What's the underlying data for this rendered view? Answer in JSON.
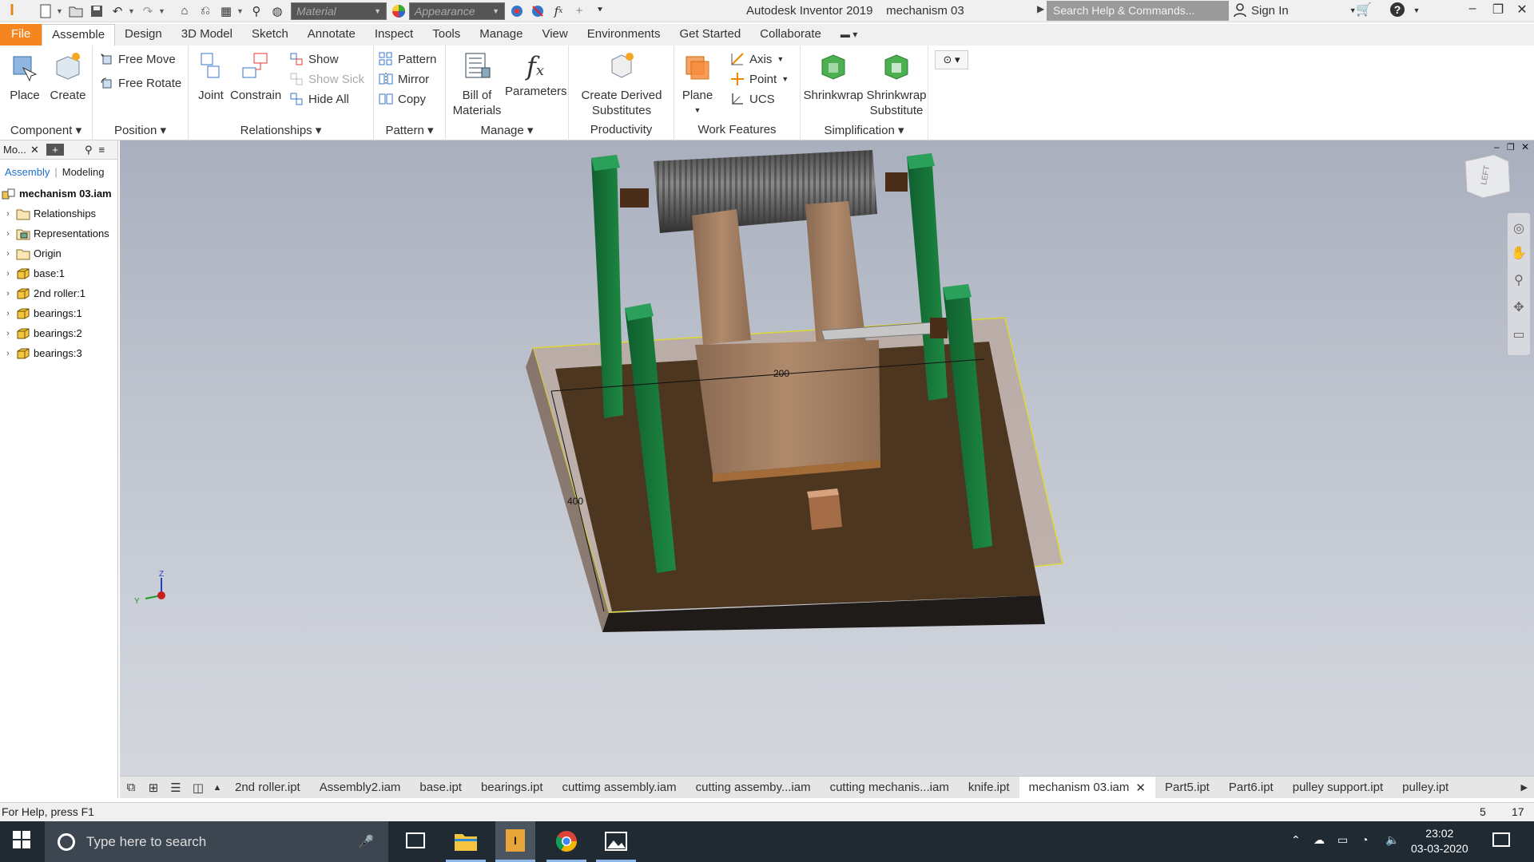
{
  "title_bar": {
    "app_name": "Autodesk Inventor 2019",
    "document_name": "mechanism 03",
    "material_placeholder": "Material",
    "appearance_placeholder": "Appearance",
    "search_placeholder": "Search Help & Commands...",
    "sign_in": "Sign In",
    "icons": [
      "inventor-logo-icon",
      "new-icon",
      "open-icon",
      "save-icon",
      "undo-icon",
      "redo-icon",
      "home-icon",
      "return-icon",
      "select-icon",
      "measure-icon",
      "update-icon",
      "color-icon",
      "clear-appearance-icon",
      "fx-icon",
      "plus-icon",
      "customize-icon"
    ]
  },
  "ribbon_tabs": [
    "File",
    "Assemble",
    "Design",
    "3D Model",
    "Sketch",
    "Annotate",
    "Inspect",
    "Tools",
    "Manage",
    "View",
    "Environments",
    "Get Started",
    "Collaborate"
  ],
  "ribbon": {
    "component": {
      "title": "Component",
      "place": "Place",
      "create": "Create"
    },
    "position": {
      "title": "Position",
      "free_move": "Free Move",
      "free_rotate": "Free Rotate"
    },
    "relationships": {
      "title": "Relationships",
      "joint": "Joint",
      "constrain": "Constrain",
      "show": "Show",
      "show_sick": "Show Sick",
      "hide_all": "Hide All"
    },
    "pattern": {
      "title": "Pattern",
      "pattern": "Pattern",
      "mirror": "Mirror",
      "copy": "Copy"
    },
    "manage": {
      "title": "Manage",
      "bom_line1": "Bill of",
      "bom_line2": "Materials",
      "parameters": "Parameters"
    },
    "productivity": {
      "title": "Productivity",
      "line1": "Create Derived",
      "line2": "Substitutes"
    },
    "work_features": {
      "title": "Work Features",
      "plane": "Plane",
      "axis": "Axis",
      "point": "Point",
      "ucs": "UCS"
    },
    "simplification": {
      "title": "Simplification",
      "shrinkwrap": "Shrinkwrap",
      "sub_line1": "Shrinkwrap",
      "sub_line2": "Substitute"
    }
  },
  "browser": {
    "header_label": "Mo...",
    "tab_assembly": "Assembly",
    "tab_modeling": "Modeling",
    "root": "mechanism 03.iam",
    "items": [
      {
        "label": "Relationships",
        "icon": "folder-icon"
      },
      {
        "label": "Representations",
        "icon": "representations-icon"
      },
      {
        "label": "Origin",
        "icon": "folder-icon"
      },
      {
        "label": "base:1",
        "icon": "part-icon"
      },
      {
        "label": "2nd roller:1",
        "icon": "part-icon"
      },
      {
        "label": "bearings:1",
        "icon": "part-icon"
      },
      {
        "label": "bearings:2",
        "icon": "part-icon"
      },
      {
        "label": "bearings:3",
        "icon": "part-icon"
      }
    ]
  },
  "viewport": {
    "dim_width": "200",
    "dim_depth": "400",
    "viewcube_label": "LEFT",
    "axis_z": "Z",
    "axis_y": "Y"
  },
  "doc_tabs": [
    "2nd roller.ipt",
    "Assembly2.iam",
    "base.ipt",
    "bearings.ipt",
    "cuttimg assembly.iam",
    "cutting assemby...iam",
    "cutting mechanis...iam",
    "knife.ipt",
    "mechanism 03.iam",
    "Part5.ipt",
    "Part6.ipt",
    "pulley support.ipt",
    "pulley.ipt"
  ],
  "active_doc_tab": "mechanism 03.iam",
  "status": {
    "help": "For Help, press F1",
    "count1": "5",
    "count2": "17"
  },
  "taskbar": {
    "search_placeholder": "Type here to search",
    "time": "23:02",
    "date": "03-03-2020"
  }
}
